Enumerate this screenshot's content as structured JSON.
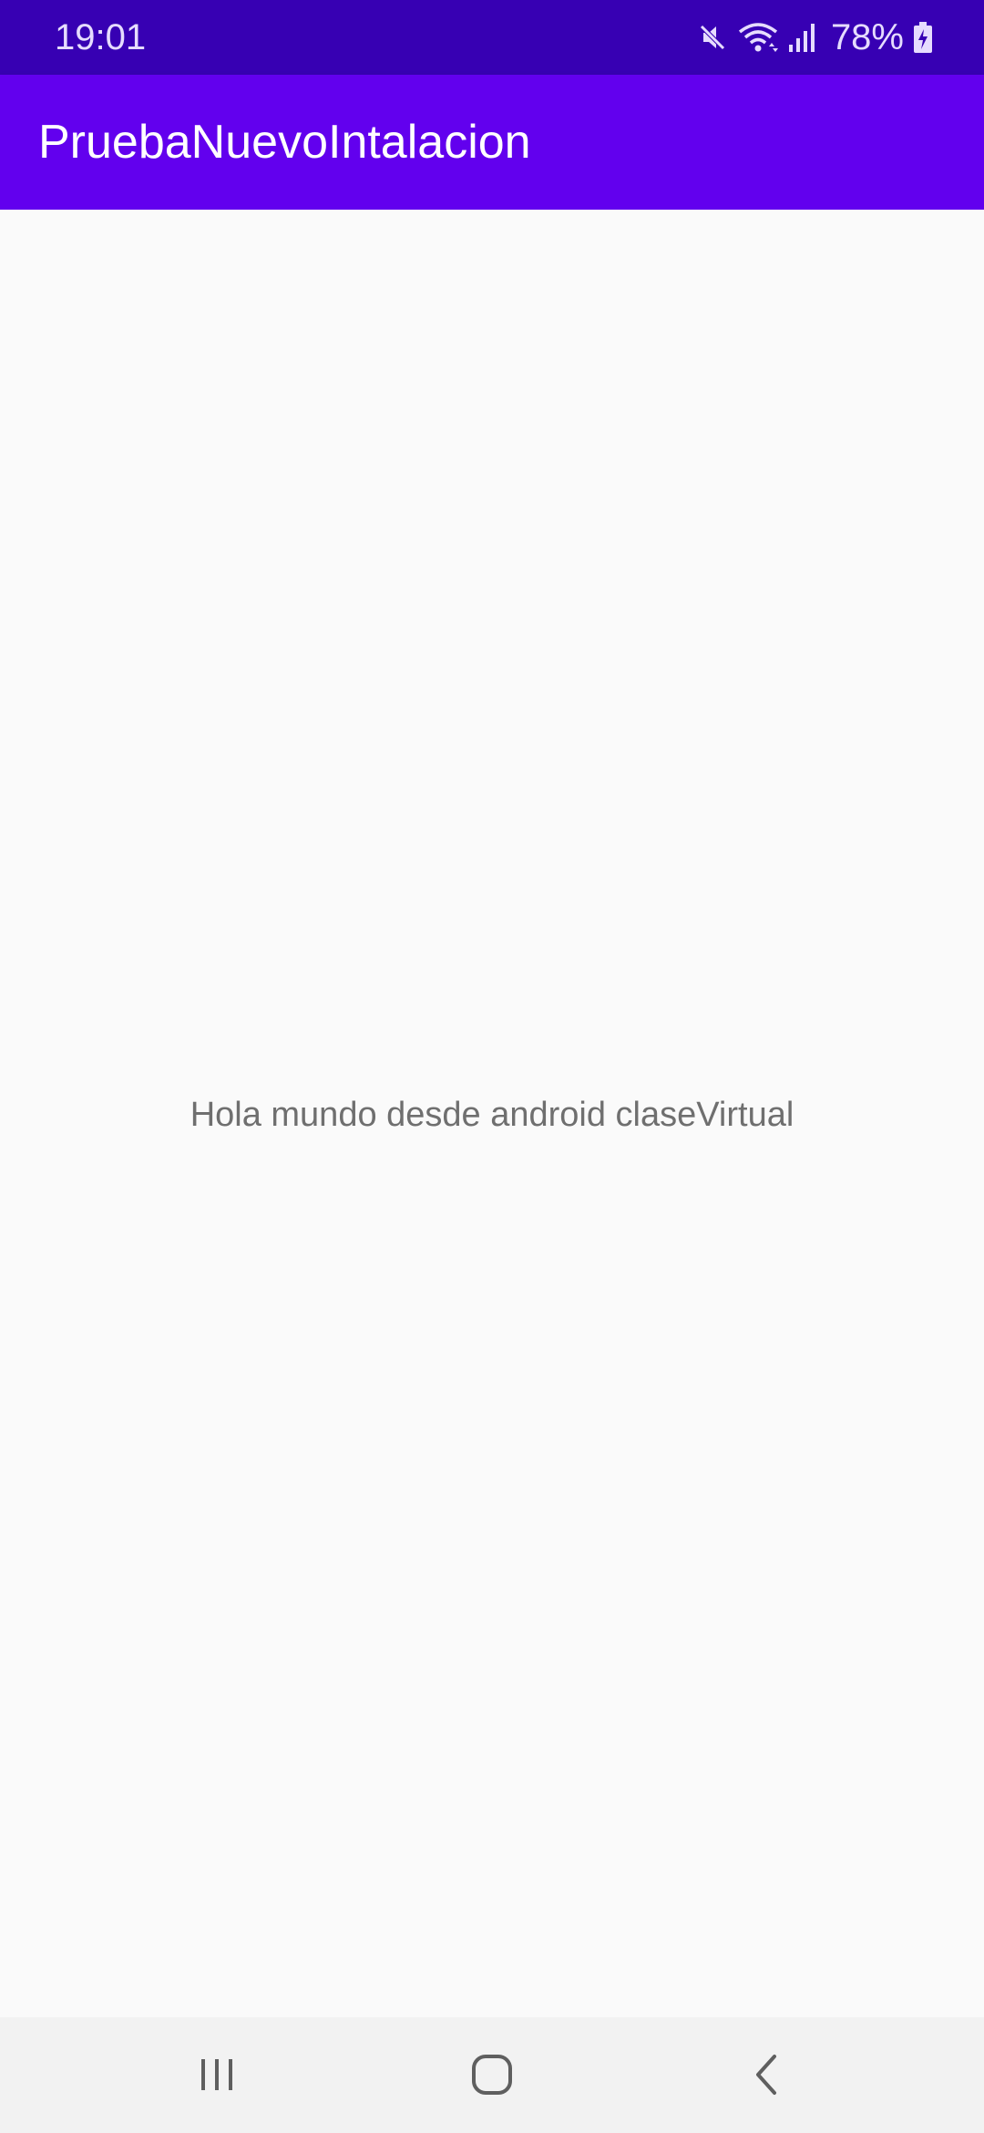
{
  "status_bar": {
    "time": "19:01",
    "battery_percent": "78%",
    "icons": [
      "mute-icon",
      "wifi-icon",
      "signal-icon",
      "battery-charging-icon"
    ]
  },
  "app_bar": {
    "title": "PruebaNuevoIntalacion"
  },
  "main": {
    "text": "Hola mundo desde android claseVirtual"
  },
  "nav_bar": {
    "icons": [
      "recent-apps-icon",
      "home-icon",
      "back-icon"
    ]
  },
  "colors": {
    "status_bar": "#3700b3",
    "app_bar": "#6200ee",
    "background": "#fafafa",
    "text": "#6f6f6f",
    "nav_bar": "#f2f2f2"
  }
}
